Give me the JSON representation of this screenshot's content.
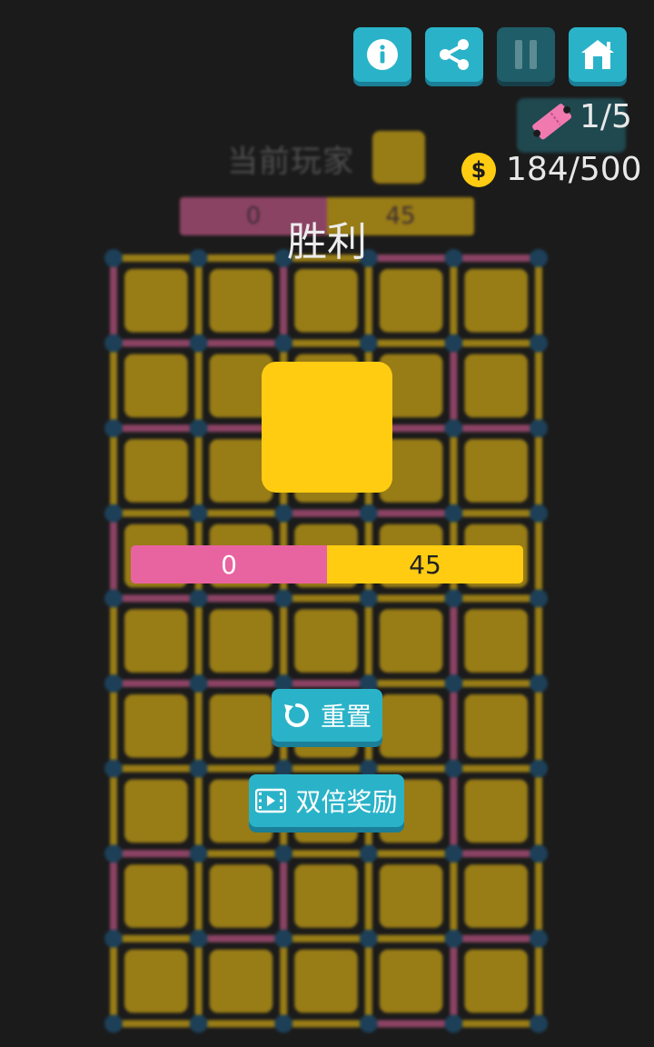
{
  "colors": {
    "background": "#1b1b1b",
    "player_pink": "#e864a0",
    "player_yellow": "#ffcc12",
    "button_teal": "#2ab3c8",
    "dot_blue": "#1f5f8a"
  },
  "top_bar": {
    "buttons": [
      {
        "name": "info",
        "icon": "info-icon"
      },
      {
        "name": "share",
        "icon": "share-icon"
      },
      {
        "name": "pause",
        "icon": "pause-icon"
      },
      {
        "name": "home",
        "icon": "home-icon"
      }
    ],
    "tickets": "1/5",
    "coins": "184/500"
  },
  "status": {
    "current_player_label": "当前玩家",
    "score_pink": "0",
    "score_yellow": "45"
  },
  "board": {
    "cols": 5,
    "rows": 9,
    "box_owner": "yellow",
    "horizontal_edges": [
      [
        "y",
        "y",
        "y",
        "p",
        "p"
      ],
      [
        "p",
        "p",
        "y",
        "y",
        "y"
      ],
      [
        "p",
        "p",
        "y",
        "p",
        "p"
      ],
      [
        "y",
        "y",
        "p",
        "p",
        "y"
      ],
      [
        "p",
        "p",
        "y",
        "y",
        "y"
      ],
      [
        "p",
        "p",
        "p",
        "y",
        "y"
      ],
      [
        "y",
        "y",
        "y",
        "y",
        "y"
      ],
      [
        "p",
        "y",
        "y",
        "y",
        "p"
      ],
      [
        "y",
        "p",
        "y",
        "y",
        "p"
      ],
      [
        "y",
        "y",
        "y",
        "p",
        "y"
      ]
    ],
    "vertical_edges": [
      [
        "p",
        "y",
        "p",
        "y",
        "y",
        "y"
      ],
      [
        "y",
        "y",
        "y",
        "y",
        "p",
        "y"
      ],
      [
        "y",
        "y",
        "y",
        "y",
        "y",
        "y"
      ],
      [
        "p",
        "y",
        "y",
        "y",
        "y",
        "y"
      ],
      [
        "y",
        "y",
        "y",
        "y",
        "p",
        "y"
      ],
      [
        "y",
        "y",
        "y",
        "y",
        "p",
        "y"
      ],
      [
        "y",
        "y",
        "y",
        "y",
        "p",
        "y"
      ],
      [
        "p",
        "y",
        "p",
        "y",
        "y",
        "y"
      ],
      [
        "y",
        "y",
        "y",
        "y",
        "p",
        "y"
      ]
    ]
  },
  "result": {
    "title": "胜利",
    "winner": "yellow",
    "score_pink": "0",
    "score_yellow": "45",
    "score_share_pink": 0.5,
    "reset_label": "重置",
    "double_reward_label": "双倍奖励"
  }
}
